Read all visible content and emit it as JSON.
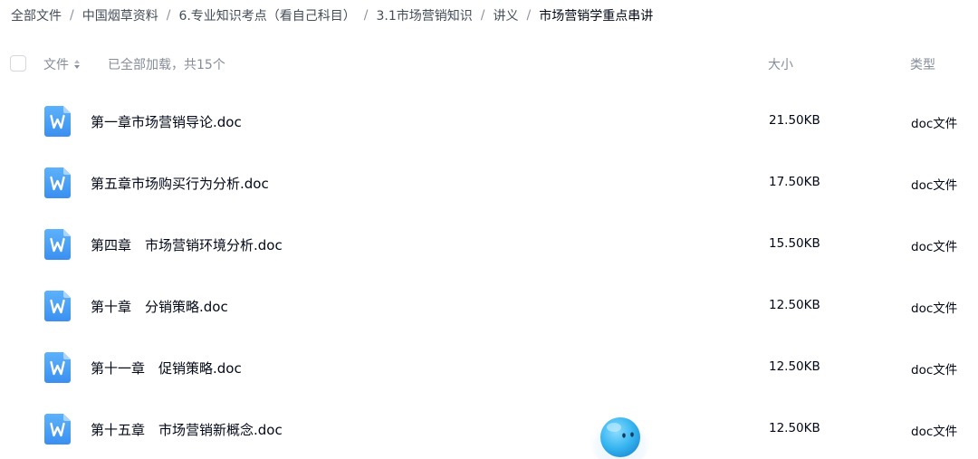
{
  "breadcrumb": [
    {
      "label": "全部文件"
    },
    {
      "label": "中国烟草资料"
    },
    {
      "label": "6.专业知识考点（看自己科目）"
    },
    {
      "label": "3.1市场营销知识"
    },
    {
      "label": "讲义"
    },
    {
      "label": "市场营销学重点串讲"
    }
  ],
  "breadcrumb_separator": "/",
  "header": {
    "file_label": "文件",
    "loaded_text": "已全部加载，共15个",
    "size_label": "大小",
    "type_label": "类型"
  },
  "files": [
    {
      "name": "第一章市场营销导论.doc",
      "size": "21.50KB",
      "type": "doc文件",
      "icon": "word-doc-icon"
    },
    {
      "name": "第五章市场购买行为分析.doc",
      "size": "17.50KB",
      "type": "doc文件",
      "icon": "word-doc-icon"
    },
    {
      "name": "第四章　市场营销环境分析.doc",
      "size": "15.50KB",
      "type": "doc文件",
      "icon": "word-doc-icon"
    },
    {
      "name": "第十章　分销策略.doc",
      "size": "12.50KB",
      "type": "doc文件",
      "icon": "word-doc-icon"
    },
    {
      "name": "第十一章　促销策略.doc",
      "size": "12.50KB",
      "type": "doc文件",
      "icon": "word-doc-icon"
    },
    {
      "name": "第十五章　市场营销新概念.doc",
      "size": "12.50KB",
      "type": "doc文件",
      "icon": "word-doc-icon"
    }
  ],
  "colors": {
    "text_primary": "#03081a",
    "text_secondary": "#878c9c",
    "icon_blue": "#4ba3f7",
    "mascot_blue": "#38b6f0"
  }
}
